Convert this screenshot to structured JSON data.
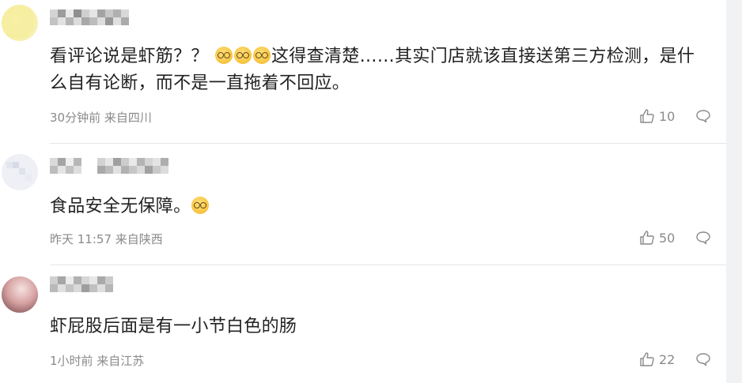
{
  "comments": [
    {
      "text_a": "看评论说是虾筋？？",
      "emojis": [
        "dizzy-face-emoji",
        "glasses-face-emoji",
        "glasses-face-emoji"
      ],
      "text_b": "这得查清楚……其实门店就该直接送第三方检测，是什么自有论断，而不是一直拖着不回应。",
      "meta": "30分钟前 来自四川",
      "likes": "10"
    },
    {
      "text_a": "食品安全无保障。",
      "emojis": [
        "nerd-face-emoji"
      ],
      "meta": "昨天 11:57 来自陕西",
      "likes": "50"
    },
    {
      "text_a": "虾屁股后面是有一小节白色的肠",
      "meta": "1小时前 来自江苏",
      "likes": "22"
    }
  ],
  "colors": {
    "text": "#222222",
    "meta": "#8a8a8a",
    "divider": "#e6e6e6",
    "scrollbar": "#f1f2f4"
  }
}
